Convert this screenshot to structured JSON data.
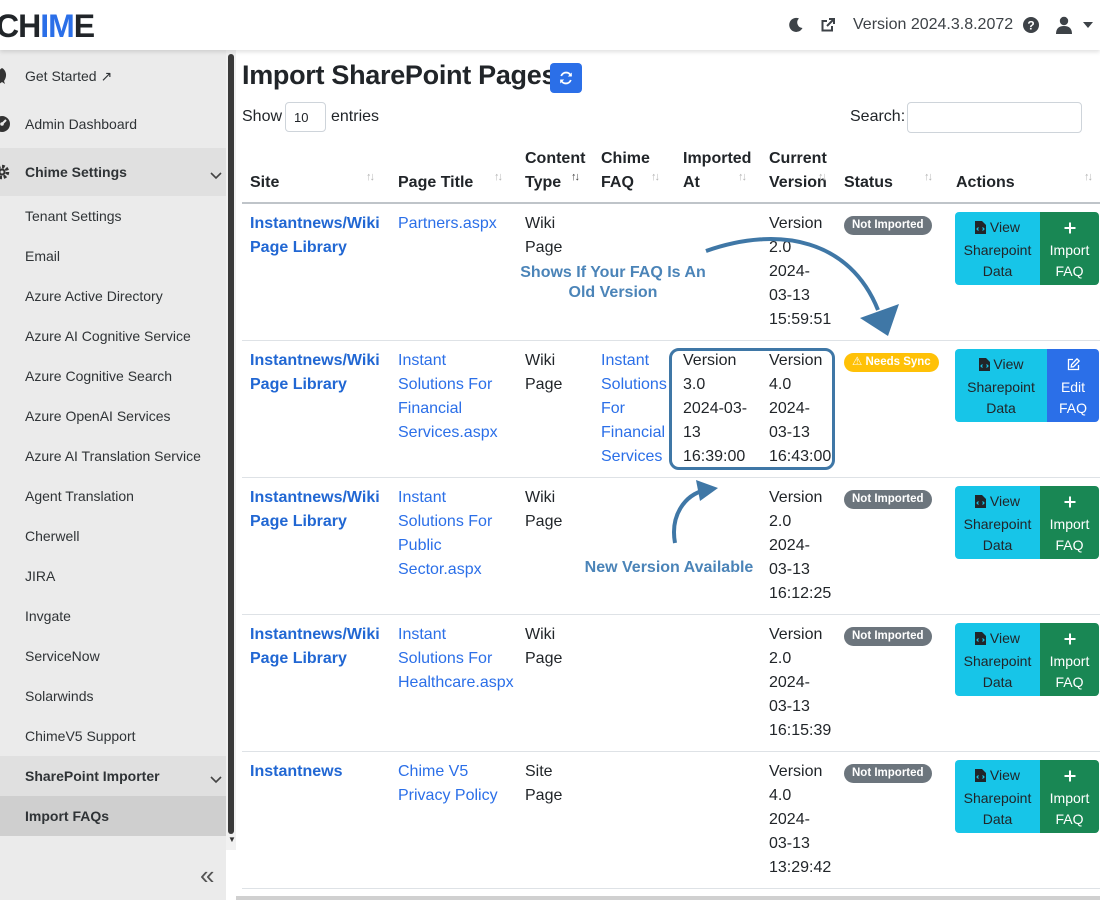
{
  "header": {
    "logo_start": "CH",
    "logo_accent": "IM",
    "logo_end": "E",
    "version": "Version 2024.3.8.2072",
    "icons": [
      "moon-icon",
      "external-link-icon",
      "help-icon",
      "user-icon",
      "caret-down-icon"
    ]
  },
  "sidebar": {
    "items": [
      {
        "label": "Get Started ↗",
        "icon": "rocket-icon"
      },
      {
        "label": "Admin Dashboard",
        "icon": "gauge-icon"
      },
      {
        "label": "Chime Settings",
        "icon": "gear-icon"
      },
      {
        "label": "Tenant Settings"
      },
      {
        "label": "Email"
      },
      {
        "label": "Azure Active Directory"
      },
      {
        "label": "Azure AI Cognitive Service"
      },
      {
        "label": "Azure Cognitive Search"
      },
      {
        "label": "Azure OpenAI Services"
      },
      {
        "label": "Azure AI Translation Service"
      },
      {
        "label": "Agent Translation"
      },
      {
        "label": "Cherwell"
      },
      {
        "label": "JIRA"
      },
      {
        "label": "Invgate"
      },
      {
        "label": "ServiceNow"
      },
      {
        "label": "Solarwinds"
      },
      {
        "label": "ChimeV5 Support"
      },
      {
        "label": "SharePoint Importer"
      },
      {
        "label": "Import FAQs"
      }
    ],
    "collapse_label": "«"
  },
  "main": {
    "title": "Import SharePoint Pages",
    "show_label": "Show",
    "entries_value": "10",
    "entries_label": "entries",
    "search_label": "Search:",
    "search_value": "",
    "columns": {
      "site": "Site",
      "page_title": "Page Title",
      "content_type_1": "Content",
      "content_type_2": "Type",
      "chime_faq_1": "Chime",
      "chime_faq_2": "FAQ",
      "imported_at_1": "Imported",
      "imported_at_2": "At",
      "current_version_1": "Current",
      "current_version_2": "Version",
      "status": "Status",
      "actions": "Actions"
    },
    "rows": [
      {
        "site": [
          "Instantnews/Wiki",
          "Page Library"
        ],
        "page_title": [
          "Partners.aspx"
        ],
        "content_type": [
          "Wiki",
          "Page"
        ],
        "chime_faq": [],
        "imported_at": [],
        "current_version": [
          "Version",
          "2.0",
          "2024-",
          "03-13",
          "15:59:51"
        ],
        "status": "Not Imported",
        "action_view": [
          "View",
          "Sharepoint",
          "Data"
        ],
        "action_second": [
          "Import",
          "FAQ"
        ]
      },
      {
        "site": [
          "Instantnews/Wiki",
          "Page Library"
        ],
        "page_title": [
          "Instant",
          "Solutions For",
          "Financial",
          "Services.aspx"
        ],
        "content_type": [
          "Wiki",
          "Page"
        ],
        "chime_faq": [
          "Instant",
          "Solutions",
          "For",
          "Financial",
          "Services"
        ],
        "imported_at": [
          "Version",
          "3.0",
          "2024-03-",
          "13",
          "16:39:00"
        ],
        "current_version": [
          "Version",
          "4.0",
          "2024-",
          "03-13",
          "16:43:00"
        ],
        "status": "⚠ Needs Sync",
        "action_view": [
          "View",
          "Sharepoint",
          "Data"
        ],
        "action_second": [
          "Edit",
          "FAQ"
        ]
      },
      {
        "site": [
          "Instantnews/Wiki",
          "Page Library"
        ],
        "page_title": [
          "Instant",
          "Solutions For",
          "Public",
          "Sector.aspx"
        ],
        "content_type": [
          "Wiki",
          "Page"
        ],
        "chime_faq": [],
        "imported_at": [],
        "current_version": [
          "Version",
          "2.0",
          "2024-",
          "03-13",
          "16:12:25"
        ],
        "status": "Not Imported",
        "action_view": [
          "View",
          "Sharepoint",
          "Data"
        ],
        "action_second": [
          "Import",
          "FAQ"
        ]
      },
      {
        "site": [
          "Instantnews/Wiki",
          "Page Library"
        ],
        "page_title": [
          "Instant",
          "Solutions For",
          "Healthcare.aspx"
        ],
        "content_type": [
          "Wiki",
          "Page"
        ],
        "chime_faq": [],
        "imported_at": [],
        "current_version": [
          "Version",
          "2.0",
          "2024-",
          "03-13",
          "16:15:39"
        ],
        "status": "Not Imported",
        "action_view": [
          "View",
          "Sharepoint",
          "Data"
        ],
        "action_second": [
          "Import",
          "FAQ"
        ]
      },
      {
        "site": [
          "Instantnews"
        ],
        "page_title": [
          "Chime V5",
          "Privacy Policy"
        ],
        "content_type": [
          "Site",
          "Page"
        ],
        "chime_faq": [],
        "imported_at": [],
        "current_version": [
          "Version",
          "4.0",
          "2024-",
          "03-13",
          "13:29:42"
        ],
        "status": "Not Imported",
        "action_view": [
          "View",
          "Sharepoint",
          "Data"
        ],
        "action_second": [
          "Import",
          "FAQ"
        ]
      }
    ]
  },
  "annotations": {
    "old_version_1": "Shows If Your FAQ Is An",
    "old_version_2": "Old Version",
    "new_version": "New Version Available"
  },
  "colors": {
    "primary": "#2b6fe8",
    "info": "#17c5e8",
    "success": "#198754",
    "warning": "#ffc107",
    "secondary": "#6c757d",
    "annotation": "#4b84b8"
  }
}
